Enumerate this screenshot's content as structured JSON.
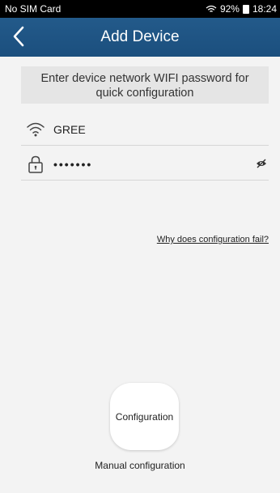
{
  "status_bar": {
    "carrier": "No SIM Card",
    "battery": "92%",
    "time": "18:24",
    "icons": [
      "wifi-icon",
      "battery-icon"
    ]
  },
  "nav": {
    "back_icon": "chevron-left-icon",
    "title": "Add Device"
  },
  "hint": {
    "text": "Enter device network WIFI password for quick configuration"
  },
  "wifi_field": {
    "icon": "wifi-icon",
    "value": "GREE"
  },
  "password_field": {
    "icon": "lock-icon",
    "value": "•••••••",
    "toggle_icon": "eye-icon"
  },
  "help_link": "Why does configuration fail?",
  "config_button_label": "Configuration",
  "manual_link": "Manual configuration",
  "colors": {
    "nav_bar": "#1e5485",
    "background": "#f3f3f3",
    "hint_box": "#e5e5e5"
  }
}
